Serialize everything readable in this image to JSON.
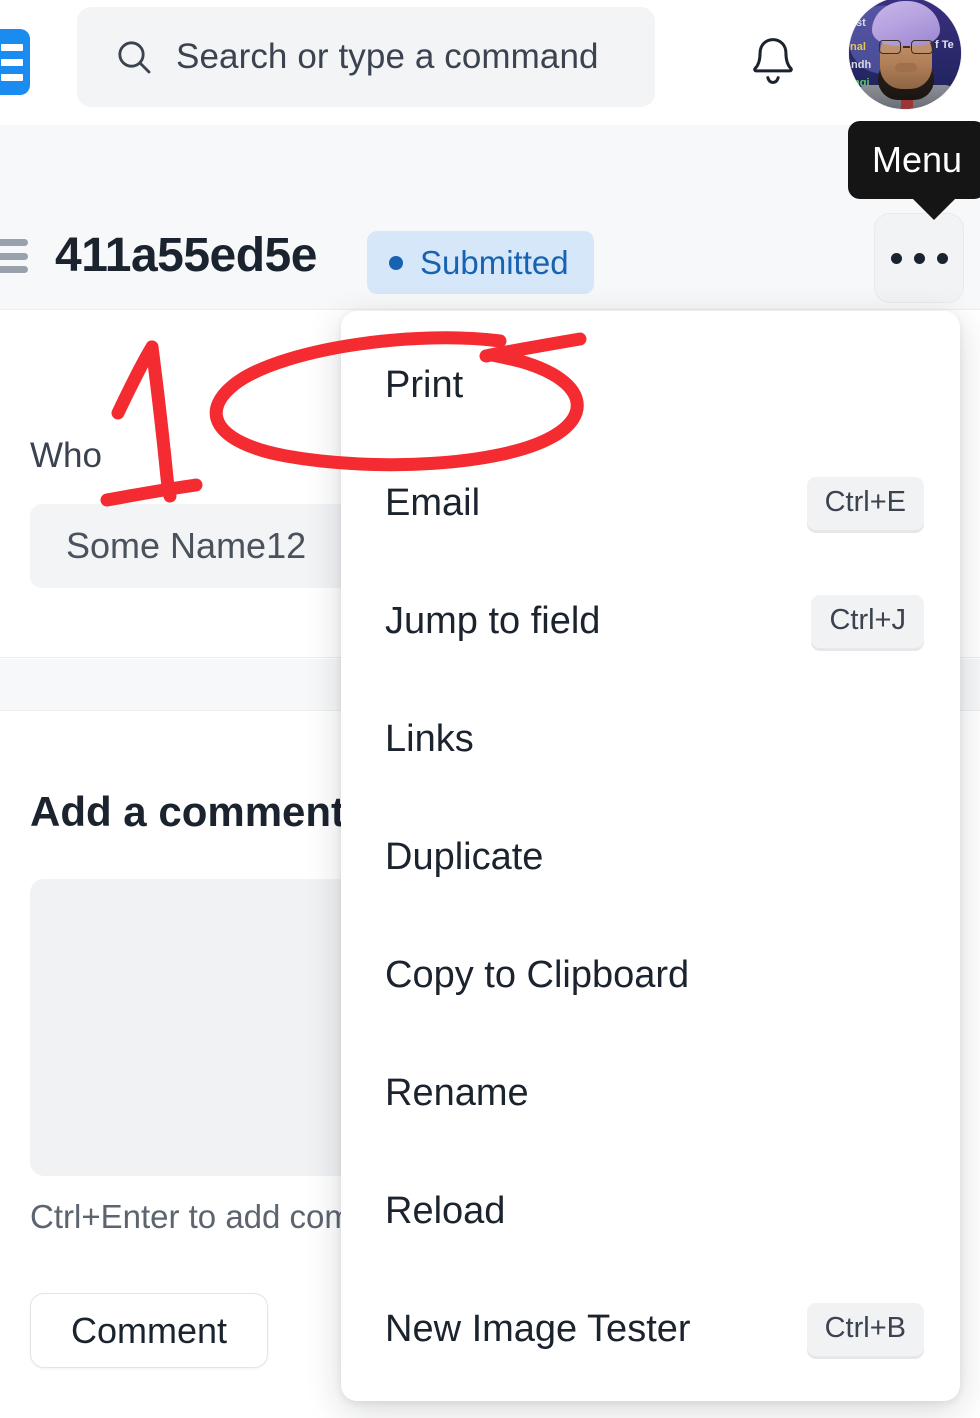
{
  "topbar": {
    "logo_icon": "app-logo-bars-icon",
    "search": {
      "icon": "search-icon",
      "value": "Search or type a command"
    },
    "notifications_icon": "bell-icon",
    "avatar_alt": "user-avatar"
  },
  "record": {
    "sidebar_toggle_icon": "hamburger-icon",
    "title": "411a55ed5e",
    "status": "Submitted",
    "menu_trigger_icon": "ellipsis-icon",
    "tooltip": "Menu"
  },
  "fields": [
    {
      "label": "Who",
      "value": "Some Name12"
    }
  ],
  "comment": {
    "heading": "Add a comment",
    "textarea_value": "",
    "hint": "Ctrl+Enter to add comment",
    "button_label": "Comment"
  },
  "menu": {
    "items": [
      {
        "label": "Print",
        "shortcut": ""
      },
      {
        "label": "Email",
        "shortcut": "Ctrl+E"
      },
      {
        "label": "Jump to field",
        "shortcut": "Ctrl+J"
      },
      {
        "label": "Links",
        "shortcut": ""
      },
      {
        "label": "Duplicate",
        "shortcut": ""
      },
      {
        "label": "Copy to Clipboard",
        "shortcut": ""
      },
      {
        "label": "Rename",
        "shortcut": ""
      },
      {
        "label": "Reload",
        "shortcut": ""
      },
      {
        "label": "New Image Tester",
        "shortcut": "Ctrl+B"
      }
    ]
  },
  "annotations": {
    "color": "#f42c31",
    "ellipse_target": "Print",
    "arrow_target": "Who / Some Name12"
  },
  "colors": {
    "accent_blue": "#1a8cf0",
    "status_bg": "#d6e7fa",
    "status_fg": "#1763b1",
    "annotation_red": "#f42c31",
    "page_bg": "#ffffff",
    "panel_gray": "#f7f8f9"
  }
}
